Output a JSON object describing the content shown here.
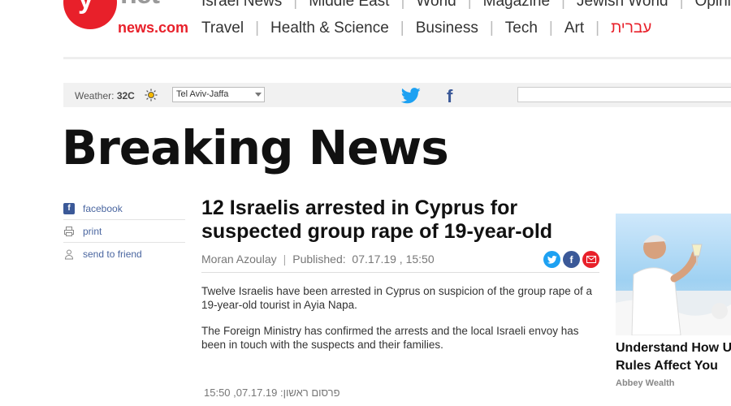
{
  "logo": {
    "letter": "y",
    "net": "net",
    "domain": "news.com"
  },
  "nav": {
    "row1": [
      "Israel News",
      "Middle East",
      "World",
      "Magazine",
      "Jewish World",
      "Opinion"
    ],
    "row2": [
      "Travel",
      "Health & Science",
      "Business",
      "Tech",
      "Art"
    ],
    "hebrew": "עברית"
  },
  "weather": {
    "label": "Weather: ",
    "temp": "32C",
    "city": "Tel Aviv-Jaffa"
  },
  "icons": {
    "sun": "sun-icon",
    "twitter": "twitter-icon",
    "facebook": "facebook-icon",
    "print": "printer-icon",
    "send": "person-icon",
    "mail": "mail-icon"
  },
  "colors": {
    "brand_red": "#e8202a",
    "facebook": "#3b5998",
    "twitter": "#1da1f2"
  },
  "page": {
    "heading": "Breaking News"
  },
  "share": {
    "facebook": "facebook",
    "print": "print",
    "send": "send to friend"
  },
  "article": {
    "title": "12 Israelis arrested in Cyprus for suspected group rape of 19-year-old",
    "author": "Moran Azoulay",
    "published_label": "Published:",
    "published_date": "07.17.19 , 15:50",
    "paragraphs": [
      "Twelve Israelis have been arrested in Cyprus on suspicion of the group rape of a 19-year-old tourist in Ayia Napa.",
      "The Foreign Ministry has confirmed the arrests and the local Israeli envoy has been in touch with the suspects and their families."
    ],
    "hebrew_published": "פרסום ראשון: 07.17.19, 15:50"
  },
  "ad": {
    "title_line1": "Understand How U",
    "title_line2": "Rules Affect You",
    "source": "Abbey Wealth"
  }
}
